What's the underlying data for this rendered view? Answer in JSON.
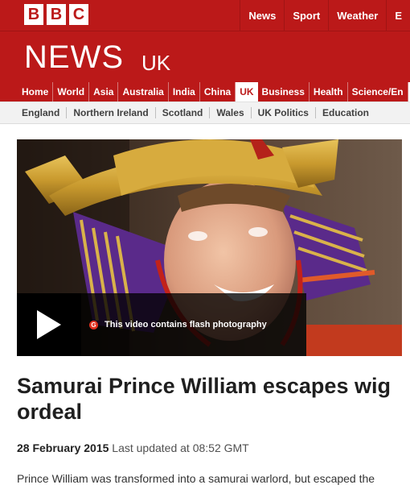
{
  "brand": {
    "logo_letters": [
      "B",
      "B",
      "C"
    ],
    "masthead_title": "NEWS",
    "masthead_sub": "UK"
  },
  "top_nav": [
    "News",
    "Sport",
    "Weather",
    "E"
  ],
  "primary_nav": {
    "items": [
      "Home",
      "World",
      "Asia",
      "Australia",
      "India",
      "China",
      "UK",
      "Business",
      "Health",
      "Science/En"
    ],
    "active": "UK"
  },
  "secondary_nav": [
    "England",
    "Northern Ireland",
    "Scotland",
    "Wales",
    "UK Politics",
    "Education"
  ],
  "video": {
    "warning_icon_letter": "G",
    "warning_text": "This video contains flash photography"
  },
  "article": {
    "headline": "Samurai Prince William escapes wig ordeal",
    "date": "28 February 2015",
    "updated": "Last updated at 08:52 GMT",
    "body": "Prince William was transformed into a samurai warlord, but escaped the"
  },
  "colors": {
    "brand_red": "#bb1919",
    "nav_active_bg": "#ffffff",
    "secondary_nav_bg": "#f2f2f2",
    "headline": "#1f1f1f"
  }
}
